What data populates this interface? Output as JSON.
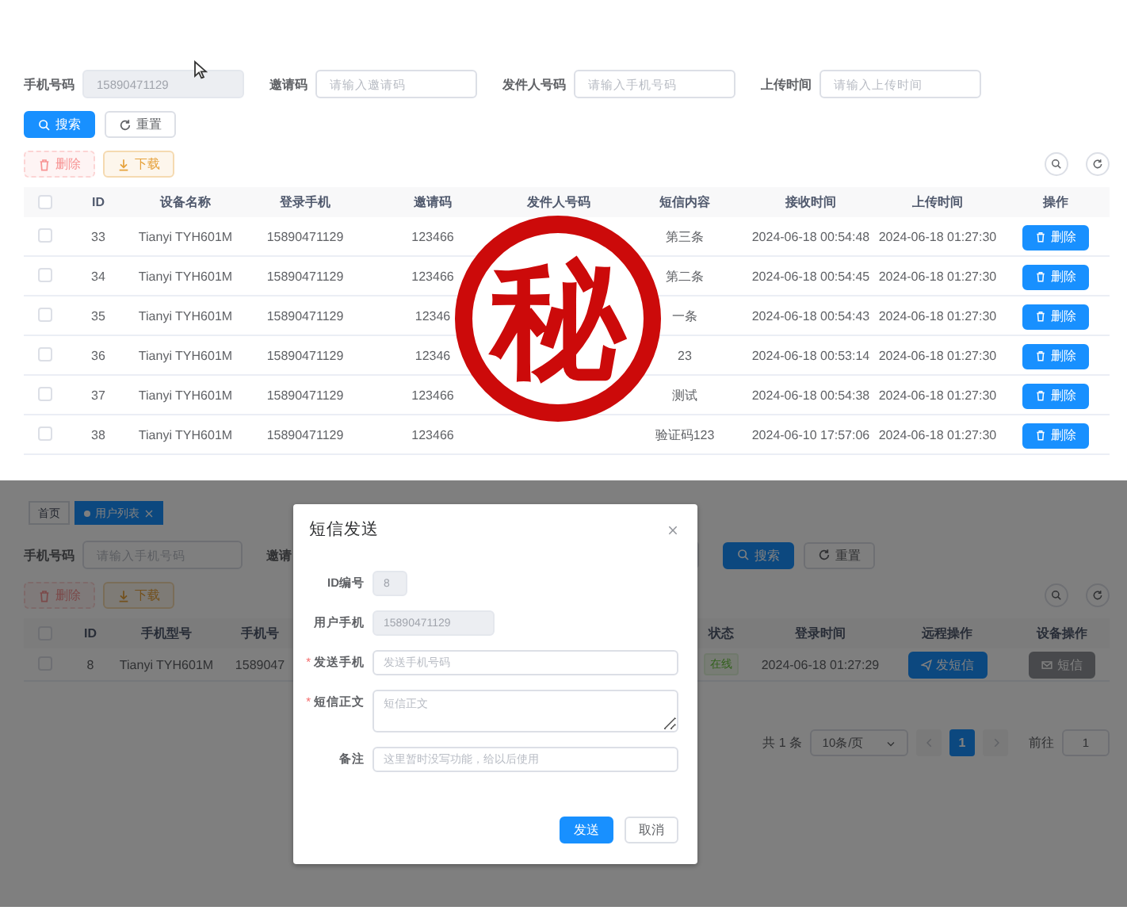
{
  "top": {
    "filters": [
      {
        "label": "手机号码",
        "value": "15890471129",
        "disabled": true
      },
      {
        "label": "邀请码",
        "placeholder": "请输入邀请码",
        "disabled": false
      },
      {
        "label": "发件人号码",
        "placeholder": "请输入手机号码",
        "disabled": false
      },
      {
        "label": "上传时间",
        "placeholder": "请输入上传时间",
        "disabled": false
      }
    ],
    "actions": [
      {
        "label": "搜索",
        "kind": "primary"
      },
      {
        "label": "重置",
        "kind": "default"
      }
    ],
    "toolbar": [
      {
        "label": "删除",
        "kind": "danger",
        "disabled": true
      },
      {
        "label": "下载",
        "kind": "warning",
        "disabled": false
      }
    ],
    "table": {
      "header_checked": false,
      "columns": [
        "ID",
        "设备名称",
        "登录手机",
        "邀请码",
        "发件人号码",
        "短信内容",
        "接收时间",
        "上传时间",
        "操作"
      ],
      "rows": [
        {
          "checked": false,
          "id": "33",
          "device": "Tianyi TYH601M",
          "phone": "15890471129",
          "invite": "123466",
          "content": "第三条",
          "received": "2024-06-18 00:54:48",
          "uploaded": "2024-06-18 01:27:30",
          "action": "删除"
        },
        {
          "checked": false,
          "id": "34",
          "device": "Tianyi TYH601M",
          "phone": "15890471129",
          "invite": "123466",
          "content": "第二条",
          "received": "2024-06-18 00:54:45",
          "uploaded": "2024-06-18 01:27:30",
          "action": "删除"
        },
        {
          "checked": false,
          "id": "35",
          "device": "Tianyi TYH601M",
          "phone": "15890471129",
          "invite": "12346",
          "content": "一条",
          "received": "2024-06-18 00:54:43",
          "uploaded": "2024-06-18 01:27:30",
          "action": "删除"
        },
        {
          "checked": false,
          "id": "36",
          "device": "Tianyi TYH601M",
          "phone": "15890471129",
          "invite": "12346",
          "content": "23",
          "received": "2024-06-18 00:53:14",
          "uploaded": "2024-06-18 01:27:30",
          "action": "删除"
        },
        {
          "checked": false,
          "id": "37",
          "device": "Tianyi TYH601M",
          "phone": "15890471129",
          "invite": "123466",
          "content": "测试",
          "received": "2024-06-18 00:54:38",
          "uploaded": "2024-06-18 01:27:30",
          "action": "删除"
        },
        {
          "checked": false,
          "id": "38",
          "device": "Tianyi TYH601M",
          "phone": "15890471129",
          "invite": "123466",
          "content": "验证码123",
          "received": "2024-06-10 17:57:06",
          "uploaded": "2024-06-18 01:27:30",
          "action": "删除"
        }
      ]
    }
  },
  "stamp": {
    "text": "秘"
  },
  "bottom": {
    "tabs": [
      {
        "label": "首页",
        "selected": false
      },
      {
        "label": "用户列表",
        "selected": true
      }
    ],
    "filters": [
      {
        "label": "手机号码",
        "placeholder": "请输入手机号码"
      },
      {
        "label": "邀请"
      }
    ],
    "actions": [
      {
        "label": "搜索",
        "kind": "primary"
      },
      {
        "label": "重置",
        "kind": "default"
      }
    ],
    "toolbar": [
      {
        "label": "删除",
        "kind": "danger",
        "disabled": true
      },
      {
        "label": "下载",
        "kind": "warning",
        "disabled": false
      }
    ],
    "table": {
      "header_checked": false,
      "columns": [
        "ID",
        "手机型号",
        "手机号",
        "状态",
        "登录时间",
        "远程操作",
        "设备操作"
      ],
      "rows": [
        {
          "checked": false,
          "id": "8",
          "model": "Tianyi TYH601M",
          "phone": "1589047",
          "status": "在线",
          "login": "2024-06-18 01:27:29",
          "remote": "发短信",
          "device_action": "短信"
        }
      ]
    },
    "pagination": {
      "total": "共 1 条",
      "page_size": "10条/页",
      "pages": [
        {
          "label": "1",
          "selected": true
        }
      ],
      "goto_label": "前往",
      "goto_value": "1"
    }
  },
  "dialog": {
    "title": "短信发送",
    "fields": [
      {
        "label": "ID编号",
        "kind": "input",
        "value": "8",
        "disabled": true
      },
      {
        "label": "用户手机",
        "kind": "input",
        "value": "15890471129",
        "disabled": true
      },
      {
        "label": "发送手机",
        "required_mark": "*",
        "kind": "input",
        "placeholder": "发送手机号码",
        "disabled": false
      },
      {
        "label": "短信正文",
        "required_mark": "*",
        "kind": "textarea",
        "placeholder": "短信正文",
        "disabled": false
      },
      {
        "label": "备注",
        "kind": "input",
        "placeholder": "这里暂时没写功能，给以后使用",
        "disabled": false
      }
    ],
    "buttons": [
      {
        "label": "发送",
        "kind": "primary"
      },
      {
        "label": "取消",
        "kind": "default"
      }
    ]
  }
}
